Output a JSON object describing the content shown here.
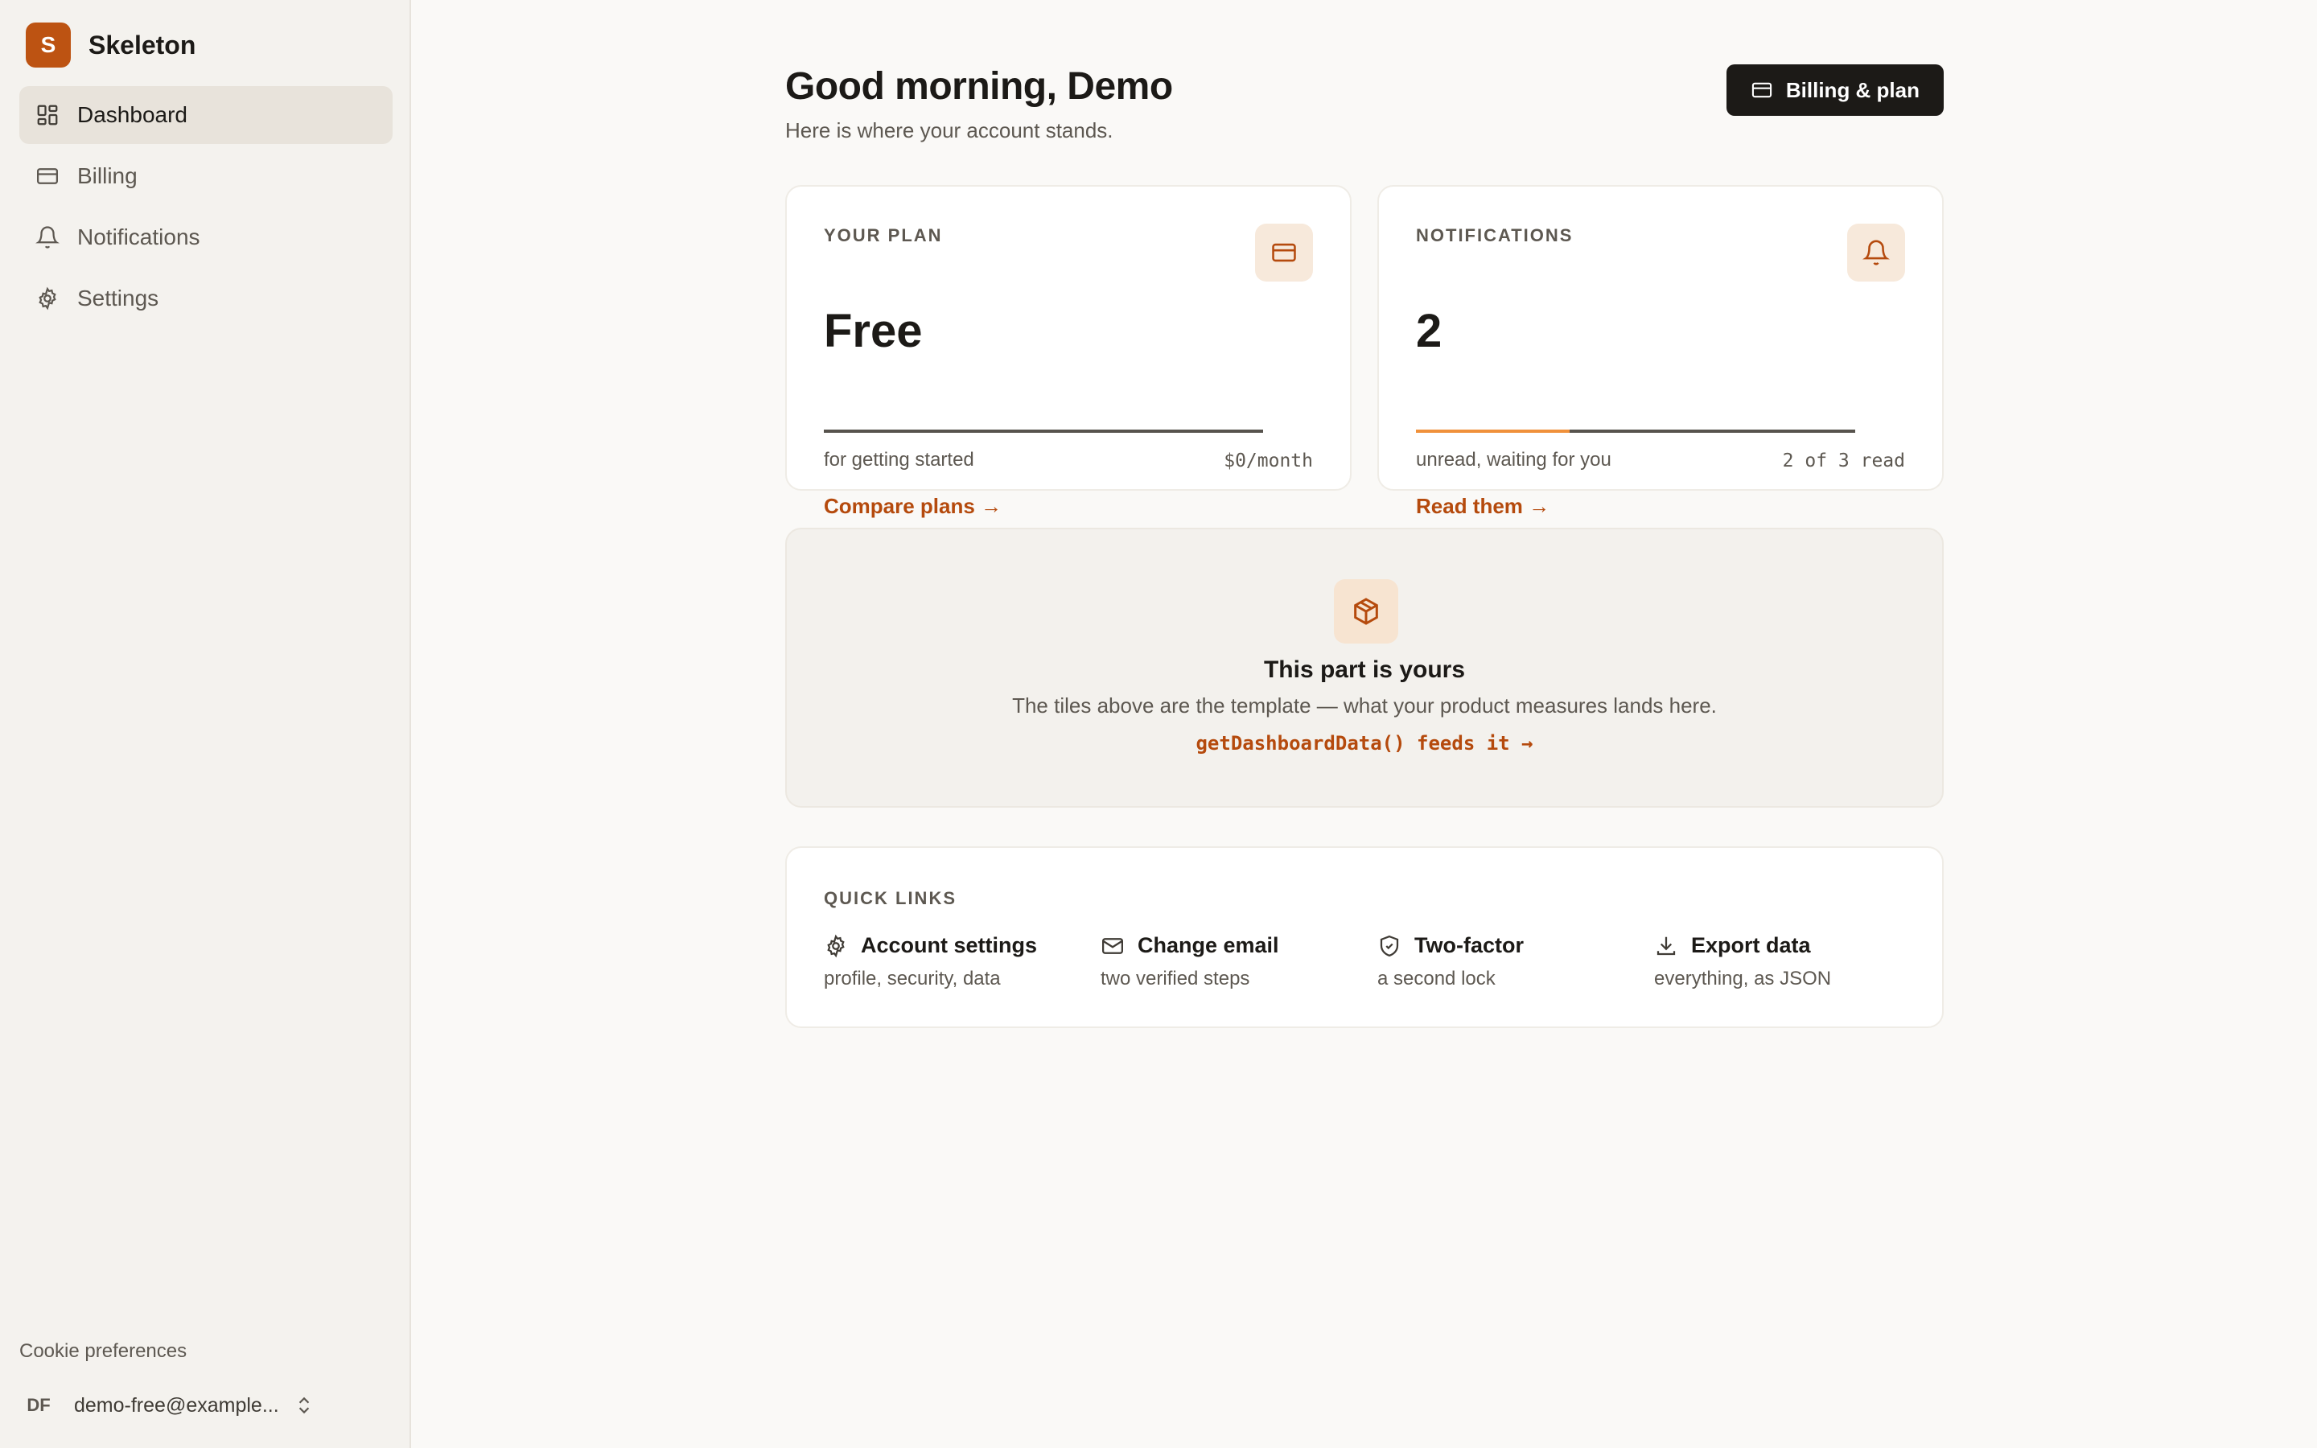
{
  "brand": {
    "initial": "S",
    "name": "Skeleton",
    "color": "#bd5312"
  },
  "sidebar": {
    "items": [
      {
        "label": "Dashboard",
        "icon": "dashboard-icon",
        "active": true
      },
      {
        "label": "Billing",
        "icon": "card-icon",
        "active": false
      },
      {
        "label": "Notifications",
        "icon": "bell-icon",
        "active": false
      },
      {
        "label": "Settings",
        "icon": "gear-icon",
        "active": false
      }
    ],
    "cookie_label": "Cookie preferences",
    "account": {
      "initials": "DF",
      "email": "demo-free@example..."
    }
  },
  "header": {
    "greeting": "Good morning, Demo",
    "subtitle": "Here is where your account stands.",
    "billing_button": "Billing & plan"
  },
  "plan_card": {
    "label": "YOUR PLAN",
    "value": "Free",
    "description": "for getting started",
    "price": "$0/month",
    "link": "Compare plans →",
    "progress": 0
  },
  "notifications_card": {
    "label": "NOTIFICATIONS",
    "value": "2",
    "description": "unread, waiting for you",
    "meta": "2 of 3 read",
    "link": "Read them →",
    "progress": 0.35
  },
  "template_panel": {
    "title": "This part is yours",
    "text": "The tiles above are the template — what your product measures lands here.",
    "code": "getDashboardData() feeds it →"
  },
  "quick_links": {
    "label": "QUICK LINKS",
    "items": [
      {
        "title": "Account settings",
        "subtitle": "profile, security, data",
        "icon": "gear-icon"
      },
      {
        "title": "Change email",
        "subtitle": "two verified steps",
        "icon": "mail-icon"
      },
      {
        "title": "Two-factor",
        "subtitle": "a second lock",
        "icon": "shield-icon"
      },
      {
        "title": "Export data",
        "subtitle": "everything, as JSON",
        "icon": "download-icon"
      }
    ]
  },
  "colors": {
    "accent": "#b54a0d",
    "progress_fill": "#f0913b",
    "dark_button": "#1c1a17"
  }
}
